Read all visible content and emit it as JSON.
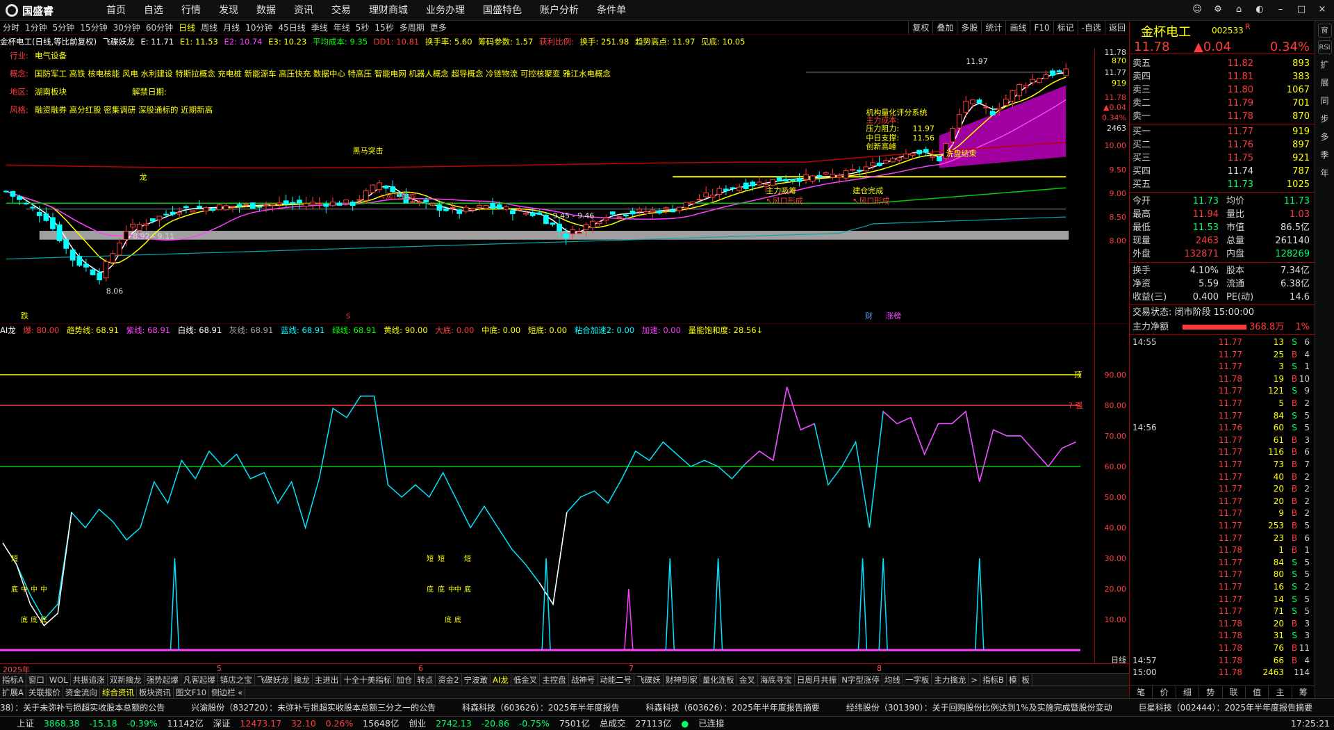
{
  "app": {
    "logo": "国盛睿",
    "menu": [
      "首页",
      "自选",
      "行情",
      "发现",
      "数据",
      "资讯",
      "交易",
      "理财商城",
      "业务办理",
      "国盛特色",
      "账户分析",
      "条件单"
    ],
    "window_buttons": [
      "chat-icon",
      "settings-icon",
      "tools-icon",
      "skin-icon",
      "minimize-icon",
      "maximize-icon",
      "close-icon"
    ]
  },
  "periods": {
    "items": [
      "分时",
      "1分钟",
      "5分钟",
      "15分钟",
      "30分钟",
      "60分钟",
      "日线",
      "周线",
      "月线",
      "10分钟",
      "45日线",
      "季线",
      "年线",
      "5秒",
      "15秒",
      "多周期",
      "更多"
    ],
    "active": "日线",
    "tools": [
      "复权",
      "叠加",
      "多股",
      "统计",
      "画线",
      "F10",
      "标记",
      "-自选",
      "返回"
    ]
  },
  "info": {
    "stock": "金杯电工(日线,等比前复权)",
    "indicator": "飞碟妖龙",
    "E": "E: 11.71",
    "E1": "E1: 11.53",
    "E2": "E2: 10.74",
    "E3": "E3: 10.23",
    "avgcost": "平均成本: 9.35",
    "dd1": "DD1: 10.81",
    "turnover": "换手率: 5.60",
    "chip": "筹码参数: 1.57",
    "profit": "获利比例:",
    "hand": "换手: 251.98",
    "trendhigh": "趋势高点: 11.97",
    "seehigh": "见底: 10.05"
  },
  "overlay": {
    "industry_label": "行业:",
    "industry": "电气设备",
    "concept_label": "概念:",
    "concept": "国防军工 高铁 核电核能 风电 水利建设 特斯拉概念 充电桩 新能源车 高压快充 数据中心 特高压 智能电网 机器人概念 超导概念 冷链物流 可控核聚变 雅江水电概念",
    "region_label": "地区:",
    "region": "湖南板块",
    "unlock_label": "解禁日期:",
    "style_label": "风格:",
    "style": "融资融券 高分红股 密集调研 深股通标的 近期新高"
  },
  "annotations": {
    "low": "8.06",
    "range1": "8.92 - 9.11",
    "range2": "9.45 - 9.46",
    "high": "11.97",
    "center_value": "11.56",
    "resist": "11.97",
    "t_dragon": "龙",
    "t_buy_attack": "黑马突击",
    "t_fengkou1": "↖风口形成",
    "t_fengkou2": "↖风口形成",
    "t_fengkou3": "↖风口形成",
    "t_main_absorb": "主力吸筹",
    "t_build_done": "建仓完成",
    "t_wash_end": "洗盘结束",
    "t_ai_score": "机构量化评分系统",
    "t_main_cost": "主力成本:",
    "t_resist_lbl": "压力阻力:",
    "t_center_lbl": "中日支撑:",
    "t_breakout": "创新高峰",
    "b_die": "跌",
    "b_s": "S",
    "b_cai": "财",
    "b_zhang": "涨榜"
  },
  "sub": {
    "name": "AI龙",
    "bao": "爆: 80.00",
    "trend": "趋势线: 68.91",
    "purple": "紫线: 68.91",
    "white": "白线: 68.91",
    "gray": "灰线: 68.91",
    "blue": "蓝线: 68.91",
    "green": "绿线: 68.91",
    "yellow": "黄线: 90.00",
    "dadi": "大底: 0.00",
    "zhongdi": "中底: 0.00",
    "duandi": "短底: 0.00",
    "jiasu2": "粘合加速2: 0.00",
    "jiasu": "加速: 0.00",
    "volsat": "量能饱和度: 28.56↓",
    "top_lbl": "顶",
    "strong_lbl": "? 强",
    "bottom_labels": [
      "短",
      "底",
      "中",
      "中",
      "中",
      "底",
      "底",
      "底",
      "短",
      "短",
      "短",
      "底",
      "底",
      "中",
      "中",
      "底",
      "底",
      "底"
    ]
  },
  "axis": {
    "main": [
      "11.78",
      "870",
      "11.77",
      "919",
      "11.78",
      "▲0.04",
      "0.34%",
      "2463",
      "10.00",
      "9.50",
      "9.00",
      "8.50",
      "8.00"
    ],
    "sub": [
      "90.00",
      "80.00",
      "70.00",
      "60.00",
      "50.00",
      "40.00",
      "30.00",
      "20.00",
      "10.00"
    ],
    "x": [
      "2025年",
      "5",
      "6",
      "7",
      "8"
    ],
    "period_label": "日线"
  },
  "tabs1": [
    "指标A",
    "窗口",
    "WOL",
    "共振追涨",
    "双新擒龙",
    "强势起爆",
    "凡客起爆",
    "镇店之宝",
    "飞碟妖龙",
    "擒龙",
    "主进出",
    "十全十美指标",
    "加仓",
    "转点",
    "资金2",
    "宁波敢",
    "AI龙",
    "低金叉",
    "主控盘",
    "战神号",
    "动能二号",
    "飞碟妖",
    "财神到家",
    "量化连板",
    "金叉",
    "海底寻宝",
    "日周月共振",
    "N字型涨停",
    "均线",
    "一字板",
    "主力擒龙",
    ">",
    "指标B",
    "模",
    "板"
  ],
  "tabs2": [
    "扩展A",
    "关联报价",
    "资金流向",
    "综合资讯",
    "板块资讯",
    "图文F10",
    "侧边栏 «"
  ],
  "news": [
    "38）：关于未弥补亏损超实收股本总额的公告",
    "兴渝股份（832720）：未弥补亏损超实收股本总额三分之一的公告",
    "科森科技（603626）：2025年半年度报告",
    "科森科技（603626）：2025年半年度报告摘要",
    "经纬股份（301390）：关于回购股份比例达到1%及实施完成暨股份变动",
    "巨星科技（002444）：2025年半年度报告摘要"
  ],
  "status": {
    "sh_label": "上证",
    "sh": "3868.38",
    "sh_chg": "-15.18",
    "sh_pct": "-0.39%",
    "sh_amt": "11142亿",
    "sz_label": "深证",
    "sz": "12473.17",
    "sz_chg": "32.10",
    "sz_pct": "0.26%",
    "sz_amt": "15648亿",
    "cy_label": "创业",
    "cy": "2742.13",
    "cy_chg": "-20.86",
    "cy_pct": "-0.75%",
    "cy_amt": "7501亿",
    "total_label": "总成交",
    "total": "27113亿",
    "conn": "已连接",
    "time": "17:25:21"
  },
  "quote": {
    "name": "金杯电工",
    "code": "002533",
    "mark": "R",
    "price": "11.78",
    "change": "▲0.04",
    "pct": "0.34%",
    "asks": [
      {
        "l": "卖五",
        "p": "11.82",
        "v": "893"
      },
      {
        "l": "卖四",
        "p": "11.81",
        "v": "383"
      },
      {
        "l": "卖三",
        "p": "11.80",
        "v": "1067"
      },
      {
        "l": "卖二",
        "p": "11.79",
        "v": "701"
      },
      {
        "l": "卖一",
        "p": "11.78",
        "v": "870"
      }
    ],
    "bids": [
      {
        "l": "买一",
        "p": "11.77",
        "v": "919"
      },
      {
        "l": "买二",
        "p": "11.76",
        "v": "897"
      },
      {
        "l": "买三",
        "p": "11.75",
        "v": "921"
      },
      {
        "l": "买四",
        "p": "11.74",
        "v": "787"
      },
      {
        "l": "买五",
        "p": "11.73",
        "v": "1025"
      }
    ],
    "stats": [
      {
        "l1": "今开",
        "v1": "11.73",
        "l2": "均价",
        "v2": "11.73"
      },
      {
        "l1": "最高",
        "v1": "11.94",
        "l2": "量比",
        "v2": "1.03"
      },
      {
        "l1": "最低",
        "v1": "11.53",
        "l2": "市值",
        "v2": "86.5亿"
      },
      {
        "l1": "现量",
        "v1": "2463",
        "l2": "总量",
        "v2": "261140"
      },
      {
        "l1": "外盘",
        "v1": "132871",
        "l2": "内盘",
        "v2": "128269"
      }
    ],
    "stats2": [
      {
        "l1": "换手",
        "v1": "4.10%",
        "l2": "股本",
        "v2": "7.34亿"
      },
      {
        "l1": "净资",
        "v1": "5.59",
        "l2": "流通",
        "v2": "6.38亿"
      },
      {
        "l1": "收益(三)",
        "v1": "0.400",
        "l2": "PE(动)",
        "v2": "14.6"
      }
    ],
    "state": "交易状态: 闭市阶段 15:00:00",
    "mainnet_label": "主力净额",
    "mainnet": "368.8万",
    "mainnet_pct": "1%",
    "ticks": [
      {
        "t": "14:55",
        "p": "11.77",
        "v": "13",
        "b": "S",
        "n": "6"
      },
      {
        "t": "",
        "p": "11.77",
        "v": "25",
        "b": "B",
        "n": "4"
      },
      {
        "t": "",
        "p": "11.77",
        "v": "3",
        "b": "S",
        "n": "1"
      },
      {
        "t": "",
        "p": "11.78",
        "v": "19",
        "b": "B",
        "n": "10"
      },
      {
        "t": "",
        "p": "11.77",
        "v": "121",
        "b": "S",
        "n": "9"
      },
      {
        "t": "",
        "p": "11.77",
        "v": "5",
        "b": "B",
        "n": "2"
      },
      {
        "t": "",
        "p": "11.77",
        "v": "84",
        "b": "S",
        "n": "5"
      },
      {
        "t": "14:56",
        "p": "11.76",
        "v": "60",
        "b": "S",
        "n": "5"
      },
      {
        "t": "",
        "p": "11.77",
        "v": "61",
        "b": "B",
        "n": "3"
      },
      {
        "t": "",
        "p": "11.77",
        "v": "116",
        "b": "B",
        "n": "6"
      },
      {
        "t": "",
        "p": "11.77",
        "v": "73",
        "b": "B",
        "n": "7"
      },
      {
        "t": "",
        "p": "11.77",
        "v": "40",
        "b": "B",
        "n": "2"
      },
      {
        "t": "",
        "p": "11.77",
        "v": "20",
        "b": "B",
        "n": "2"
      },
      {
        "t": "",
        "p": "11.77",
        "v": "20",
        "b": "B",
        "n": "2"
      },
      {
        "t": "",
        "p": "11.77",
        "v": "9",
        "b": "B",
        "n": "2"
      },
      {
        "t": "",
        "p": "11.77",
        "v": "253",
        "b": "B",
        "n": "5"
      },
      {
        "t": "",
        "p": "11.77",
        "v": "23",
        "b": "B",
        "n": "6"
      },
      {
        "t": "",
        "p": "11.78",
        "v": "1",
        "b": "B",
        "n": "1"
      },
      {
        "t": "",
        "p": "11.77",
        "v": "84",
        "b": "S",
        "n": "5"
      },
      {
        "t": "",
        "p": "11.77",
        "v": "80",
        "b": "S",
        "n": "5"
      },
      {
        "t": "",
        "p": "11.77",
        "v": "16",
        "b": "S",
        "n": "2"
      },
      {
        "t": "",
        "p": "11.77",
        "v": "14",
        "b": "S",
        "n": "5"
      },
      {
        "t": "",
        "p": "11.77",
        "v": "71",
        "b": "S",
        "n": "5"
      },
      {
        "t": "",
        "p": "11.78",
        "v": "20",
        "b": "B",
        "n": "3"
      },
      {
        "t": "",
        "p": "11.78",
        "v": "31",
        "b": "S",
        "n": "3"
      },
      {
        "t": "",
        "p": "11.78",
        "v": "76",
        "b": "B",
        "n": "11"
      },
      {
        "t": "14:57",
        "p": "11.78",
        "v": "66",
        "b": "B",
        "n": "4"
      },
      {
        "t": "15:00",
        "p": "11.78",
        "v": "2463",
        "b": "",
        "n": "114"
      }
    ],
    "tabs": [
      "笔",
      "价",
      "细",
      "势",
      "联",
      "值",
      "主",
      "筹"
    ]
  },
  "rside": [
    "窗",
    "RSI",
    "扩",
    "展",
    "同",
    "步",
    "多",
    "季",
    "年"
  ],
  "colors": {
    "up": "#ff3c3c",
    "down": "#00ffff",
    "bg": "#000000",
    "axis": "#a00000",
    "yellow": "#ffff00"
  }
}
